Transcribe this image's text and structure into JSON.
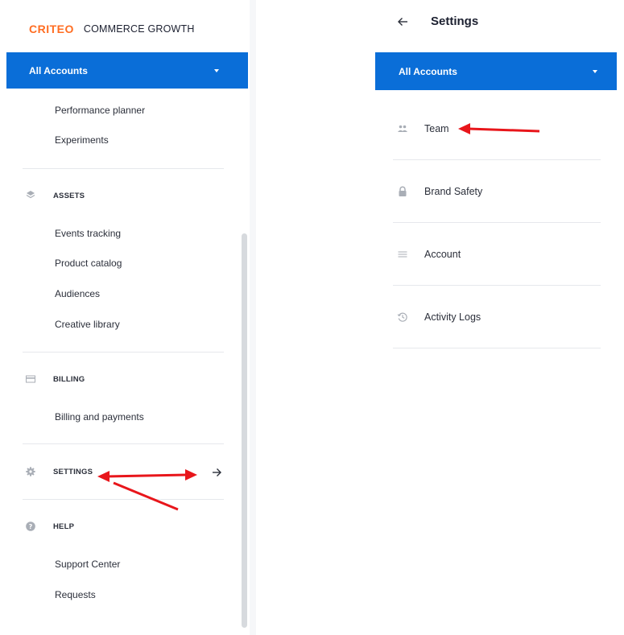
{
  "brand": {
    "logo": "CRITEO",
    "product": "COMMERCE GROWTH"
  },
  "left_nav": {
    "account_selector": "All Accounts",
    "top_items": [
      "Performance planner",
      "Experiments"
    ],
    "sections": {
      "assets": {
        "title": "ASSETS",
        "icon": "layers-icon",
        "items": [
          "Events tracking",
          "Product catalog",
          "Audiences",
          "Creative library"
        ]
      },
      "billing": {
        "title": "BILLING",
        "icon": "credit-card-icon",
        "items": [
          "Billing and payments"
        ]
      },
      "settings": {
        "title": "SETTINGS",
        "icon": "gear-icon",
        "action_icon": "arrow-right-icon"
      },
      "help": {
        "title": "HELP",
        "icon": "help-circle-icon",
        "items": [
          "Support Center",
          "Requests"
        ]
      }
    }
  },
  "settings_panel": {
    "back_icon": "arrow-left-icon",
    "title": "Settings",
    "account_selector": "All Accounts",
    "items": [
      {
        "label": "Team",
        "icon": "people-icon"
      },
      {
        "label": "Brand Safety",
        "icon": "lock-icon"
      },
      {
        "label": "Account",
        "icon": "list-icon"
      },
      {
        "label": "Activity Logs",
        "icon": "history-icon"
      }
    ]
  },
  "colors": {
    "accent_blue": "#0a6ed8",
    "brand_orange": "#ff6d22",
    "annotation_red": "#e8161b",
    "icon_grey": "#a9aeb6",
    "divider": "#e6e8ec"
  }
}
